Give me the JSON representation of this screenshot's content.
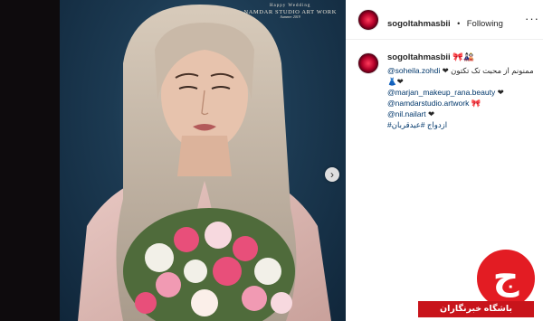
{
  "post": {
    "author": "sogoltahmasbii",
    "separator": "•",
    "follow_status": "Following",
    "more_icon": "more-horizontal-icon"
  },
  "photo": {
    "watermark_line1": "Happy Wedding",
    "watermark_line2": "NAMDAR STUDIO ART WORK",
    "watermark_line3": "Summer 2019"
  },
  "caption": {
    "author": "sogoltahmasbii",
    "author_emoji": "🎀🎎",
    "line1_mention": "@soheila.zohdi",
    "line1_text": "❤ ممنونم از محبت تک تکتون",
    "line2_text": "👗❤",
    "line3_mention": "@marjan_makeup_rana.beauty",
    "line3_suffix": "❤",
    "line4_mention": "@namdarstudio.artwork",
    "line4_suffix": "🎀",
    "line5_mention": "@nil.nailart",
    "line5_suffix": "❤",
    "line6_hashtags": "#ازدواج #عیدقربان"
  },
  "logo": {
    "glyph": "ج",
    "label": "باشگاه خبرنگاران"
  },
  "colors": {
    "mention": "#00376b",
    "logo_red": "#e31c23"
  }
}
